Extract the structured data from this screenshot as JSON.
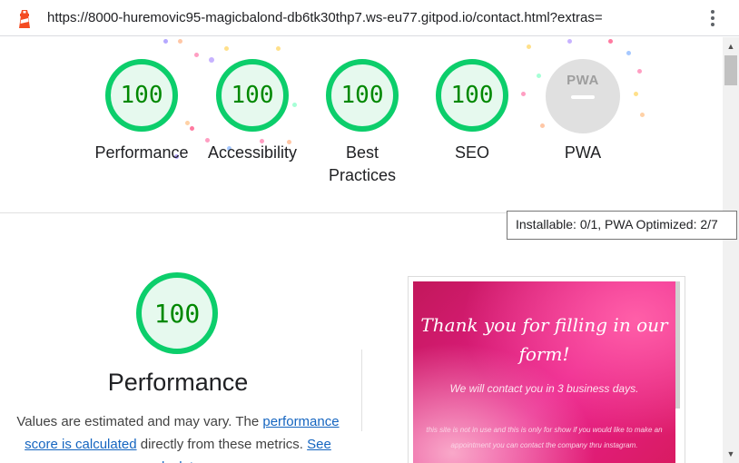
{
  "browser": {
    "url": "https://8000-huremovic95-magicbalond-db6tk30thp7.ws-eu77.gitpod.io/contact.html?extras=",
    "logo_icon": "lighthouse-icon",
    "menu_icon": "kebab-menu-icon"
  },
  "scores": [
    {
      "value": "100",
      "label": "Performance"
    },
    {
      "value": "100",
      "label": "Accessibility"
    },
    {
      "value": "100",
      "label": "Best Practices"
    },
    {
      "value": "100",
      "label": "SEO"
    }
  ],
  "pwa": {
    "badge": "PWA",
    "label": "PWA",
    "tooltip": "Installable: 0/1, PWA Optimized: 2/7"
  },
  "performance": {
    "score": "100",
    "title": "Performance",
    "desc_prefix": "Values are estimated and may vary. The ",
    "link1": "performance score is calculated",
    "desc_middle": " directly from these metrics. ",
    "link2": "See calculator."
  },
  "screenshot": {
    "title": "Thank you for filling in our form!",
    "subtitle": "We will contact you in 3 business days.",
    "small": "this site is not in use and this is only for show if you would like to make an appointment you can contact the company thru instagram."
  },
  "colors": {
    "pass": "#0cce6b",
    "pass_text": "#008800",
    "link": "#1565c0"
  }
}
